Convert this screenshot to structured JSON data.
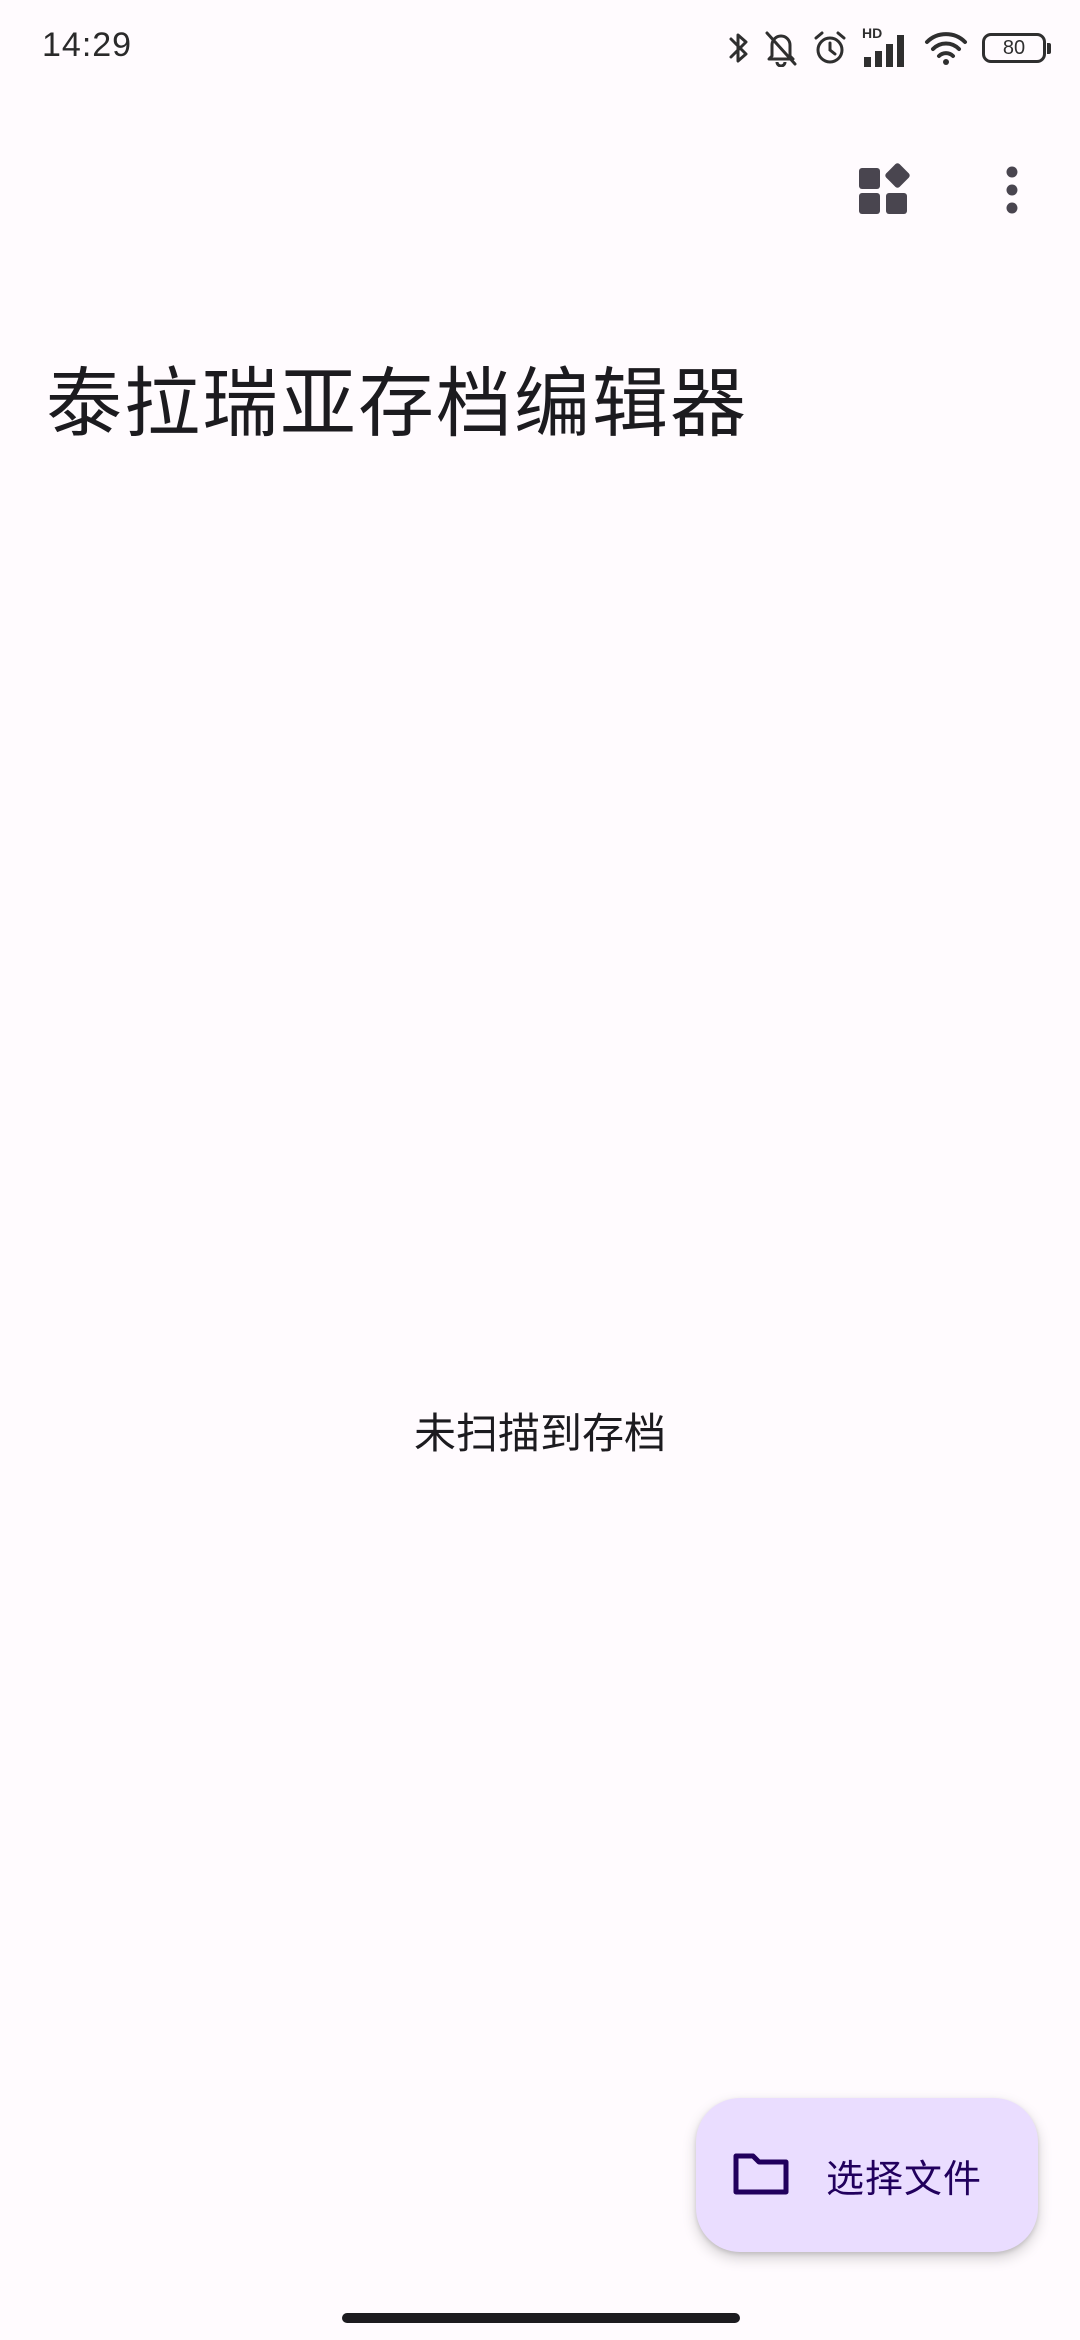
{
  "status_bar": {
    "time": "14:29",
    "hd_label": "HD",
    "battery_level": "80",
    "icons": [
      "bluetooth-icon",
      "bell-off-icon",
      "alarm-icon",
      "signal-icon",
      "wifi-icon",
      "battery-icon"
    ]
  },
  "app_bar": {
    "title": "泰拉瑞亚存档编辑器",
    "actions": [
      "widgets-icon",
      "more-vert-icon"
    ]
  },
  "main": {
    "empty_message": "未扫描到存档"
  },
  "fab": {
    "label": "选择文件",
    "icon": "folder-icon"
  },
  "colors": {
    "background": "#fffbfe",
    "fab_container": "#eaddff",
    "fab_content": "#21005d",
    "icon": "#49454f"
  }
}
